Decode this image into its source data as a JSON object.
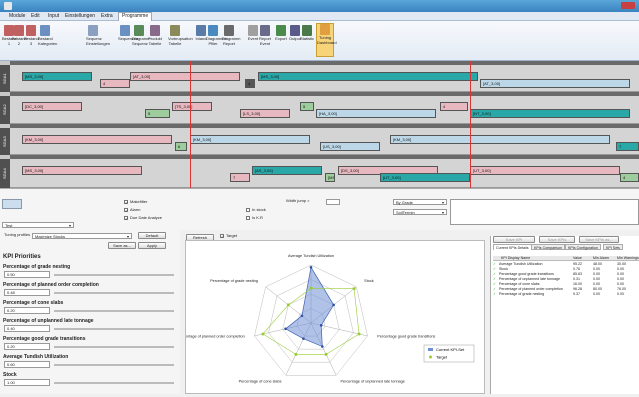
{
  "menu": [
    "Module",
    "Edit",
    "Input",
    "Einstellungen",
    "Extra",
    "Programme"
  ],
  "ribbon": {
    "buttons": [
      "Bestand 1",
      "Bestand 2",
      "Bestand 3",
      "Bestand Kategorien",
      "Sequenz Einstellungen",
      "Sequenzen",
      "Diagramm Sequenz",
      "Produkt Tabelle",
      "Vorbrupsation Tabelle",
      "Inland",
      "Diagramme Pfiler",
      "Diagramm Report",
      "Event",
      "Report Event",
      "Export",
      "Output",
      "Statistic",
      "Tuning Dashboard"
    ],
    "group_label": "Programme"
  },
  "gantt": {
    "lanes": [
      "SGA1",
      "SGA2",
      "SGA3",
      "SGA4"
    ],
    "bars": [
      {
        "lane": 0,
        "text": "[MS_3,00]"
      },
      {
        "lane": 0,
        "text": "4"
      },
      {
        "lane": 0,
        "text": "[AT_3,00]"
      },
      {
        "lane": 0,
        "text": "4"
      },
      {
        "lane": 0,
        "text": "[MS_3,00]"
      },
      {
        "lane": 0,
        "text": "[AT_3,00]"
      },
      {
        "lane": 1,
        "text": "[DC_3,00]"
      },
      {
        "lane": 1,
        "text": "5"
      },
      {
        "lane": 1,
        "text": "[TS_3,00]"
      },
      {
        "lane": 1,
        "text": "[LS_3,00]"
      },
      {
        "lane": 1,
        "text": "5"
      },
      {
        "lane": 1,
        "text": "[HA_3,00]"
      },
      {
        "lane": 1,
        "text": "4"
      },
      {
        "lane": 1,
        "text": "[NT_3,00]"
      },
      {
        "lane": 2,
        "text": "[KM_3,00]"
      },
      {
        "lane": 2,
        "text": "6"
      },
      {
        "lane": 2,
        "text": "[KM_3,00]"
      },
      {
        "lane": 2,
        "text": "[US_3,00]"
      },
      {
        "lane": 2,
        "text": "[KM_3,00]"
      },
      {
        "lane": 2,
        "text": "7"
      },
      {
        "lane": 3,
        "text": "[MS_3,00]"
      },
      {
        "lane": 3,
        "text": "7"
      },
      {
        "lane": 3,
        "text": "[AS_3,00]"
      },
      {
        "lane": 3,
        "text": "[MS_3,00]"
      },
      {
        "lane": 3,
        "text": "[DS_3,00]"
      },
      {
        "lane": 3,
        "text": "[UT_3,00]"
      },
      {
        "lane": 3,
        "text": "[UT_3,00]"
      },
      {
        "lane": 3,
        "text": "4"
      }
    ]
  },
  "controls": {
    "make_filter": "Makefilter",
    "alarm": "Alarm",
    "due_date_analyze": "Due Date Analyze",
    "width_jump": "Width jump >",
    "in_stock": "In stock",
    "is_kr": "Is K.R",
    "by_grade": "By Grade",
    "soll_termin": "SollTermin",
    "tuning_profiles": "Tuning profiles",
    "profile_value": "Maximize Stocks",
    "default_btn": "Default",
    "save_as_btn": "Save as...",
    "apply_btn": "Apply",
    "refresh_btn": "Refresh",
    "target_cb": "Target",
    "combo_value": "Test"
  },
  "kpi": {
    "title": "KPI Priorities",
    "items": [
      {
        "label": "Percentage of grade nesting",
        "value": "0.50"
      },
      {
        "label": "Percentage of planned order completion",
        "value": "0.48"
      },
      {
        "label": "Percentage of cone slabs",
        "value": "0.20"
      },
      {
        "label": "Percentage of unplanned late tonnage",
        "value": "0.40"
      },
      {
        "label": "Percentage good grade transitions",
        "value": "0.20"
      },
      {
        "label": "Average Tundish Utilization",
        "value": "0.60"
      },
      {
        "label": "Stock",
        "value": "1.00"
      }
    ]
  },
  "radar": {
    "axes": [
      "Average Tundish Utilization",
      "Stock",
      "Percentage good grade transitions",
      "Percentage of unplanned late tonnage",
      "Percentage of cone slabs",
      "Percentage of planned order completion",
      "Percentage of grade nesting"
    ],
    "current": [
      0.96,
      0.5,
      0.18,
      0.45,
      0.3,
      0.45,
      0.2
    ],
    "target": [
      0.6,
      0.95,
      0.85,
      0.6,
      0.6,
      0.85,
      0.5
    ],
    "legend": [
      "Current KPI-Set",
      "Target"
    ],
    "current_color": "#6f8fd6",
    "target_color": "#9acd32"
  },
  "right": {
    "buttons": [
      "Save KPI Configuration",
      "Save KPIs",
      "Save KPIs as..."
    ],
    "tabs": [
      "Current KPIs Details",
      "KPIs Comparison",
      "KPIs Configuration",
      "KPI Sets"
    ],
    "headers": [
      "KPI Display Name",
      "Value",
      "Min Alarm",
      "Min Warnings"
    ],
    "rows": [
      [
        "Average Tundish Utilization",
        "95.22",
        "48.00",
        "30.00"
      ],
      [
        "Stock",
        "0.76",
        "0.00",
        "0.00"
      ],
      [
        "Percentage good grade transitions",
        "85.63",
        "0.00",
        "0.00"
      ],
      [
        "Percentage of unplanned late tonnage",
        "0.31",
        "0.00",
        "0.00"
      ],
      [
        "Percentage of cone slabs",
        "16.00",
        "0.00",
        "0.00"
      ],
      [
        "Percentage of planned order completion",
        "96.28",
        "80.00",
        "76.00"
      ],
      [
        "Percentage of grade nesting",
        "9.37",
        "0.00",
        "0.00"
      ]
    ]
  }
}
